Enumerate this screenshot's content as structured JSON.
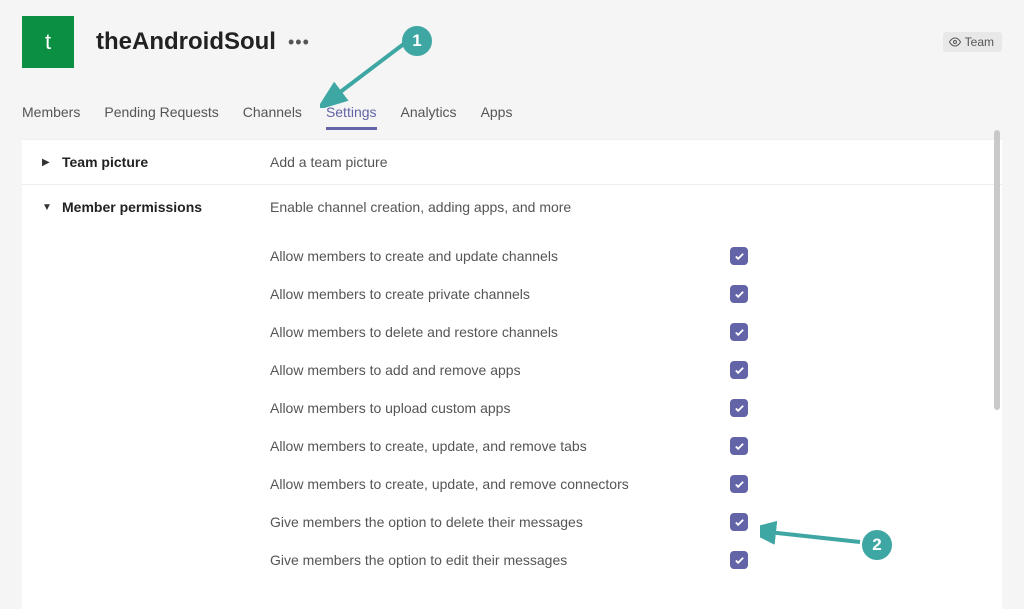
{
  "header": {
    "avatar_letter": "t",
    "team_name": "theAndroidSoul",
    "badge_label": "Team"
  },
  "tabs": {
    "items": [
      "Members",
      "Pending Requests",
      "Channels",
      "Settings",
      "Analytics",
      "Apps"
    ],
    "active_index": 3
  },
  "sections": {
    "team_picture": {
      "title": "Team picture",
      "desc": "Add a team picture"
    },
    "member_permissions": {
      "title": "Member permissions",
      "desc": "Enable channel creation, adding apps, and more",
      "items": [
        {
          "label": "Allow members to create and update channels",
          "checked": true
        },
        {
          "label": "Allow members to create private channels",
          "checked": true
        },
        {
          "label": "Allow members to delete and restore channels",
          "checked": true
        },
        {
          "label": "Allow members to add and remove apps",
          "checked": true
        },
        {
          "label": "Allow members to upload custom apps",
          "checked": true
        },
        {
          "label": "Allow members to create, update, and remove tabs",
          "checked": true
        },
        {
          "label": "Allow members to create, update, and remove connectors",
          "checked": true
        },
        {
          "label": "Give members the option to delete their messages",
          "checked": true
        },
        {
          "label": "Give members the option to edit their messages",
          "checked": true
        }
      ]
    }
  },
  "annotations": {
    "one": "1",
    "two": "2"
  }
}
